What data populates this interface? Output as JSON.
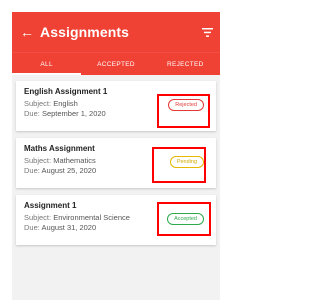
{
  "app": {
    "title": "Assignments",
    "back_icon": "arrow-back-icon",
    "filter_icon": "filter-icon",
    "accent_color": "#f04135"
  },
  "tabs": [
    {
      "label": "ALL",
      "active": true
    },
    {
      "label": "ACCEPTED",
      "active": false
    },
    {
      "label": "REJECTED",
      "active": false
    }
  ],
  "assignments": [
    {
      "title": "English Assignment 1",
      "subject_label": "Subject:",
      "subject": "English",
      "due_label": "Due:",
      "due": "September 1, 2020",
      "status": "Rejected",
      "status_color": "#e53935"
    },
    {
      "title": "Maths Assignment",
      "subject_label": "Subject:",
      "subject": "Mathematics",
      "due_label": "Due:",
      "due": "August 25, 2020",
      "status": "Pending",
      "status_color": "#e6b800"
    },
    {
      "title": "Assignment 1",
      "subject_label": "Subject:",
      "subject": "Environmental Science",
      "due_label": "Due:",
      "due": "August 31, 2020",
      "status": "Accepted",
      "status_color": "#2eaa4a"
    }
  ]
}
